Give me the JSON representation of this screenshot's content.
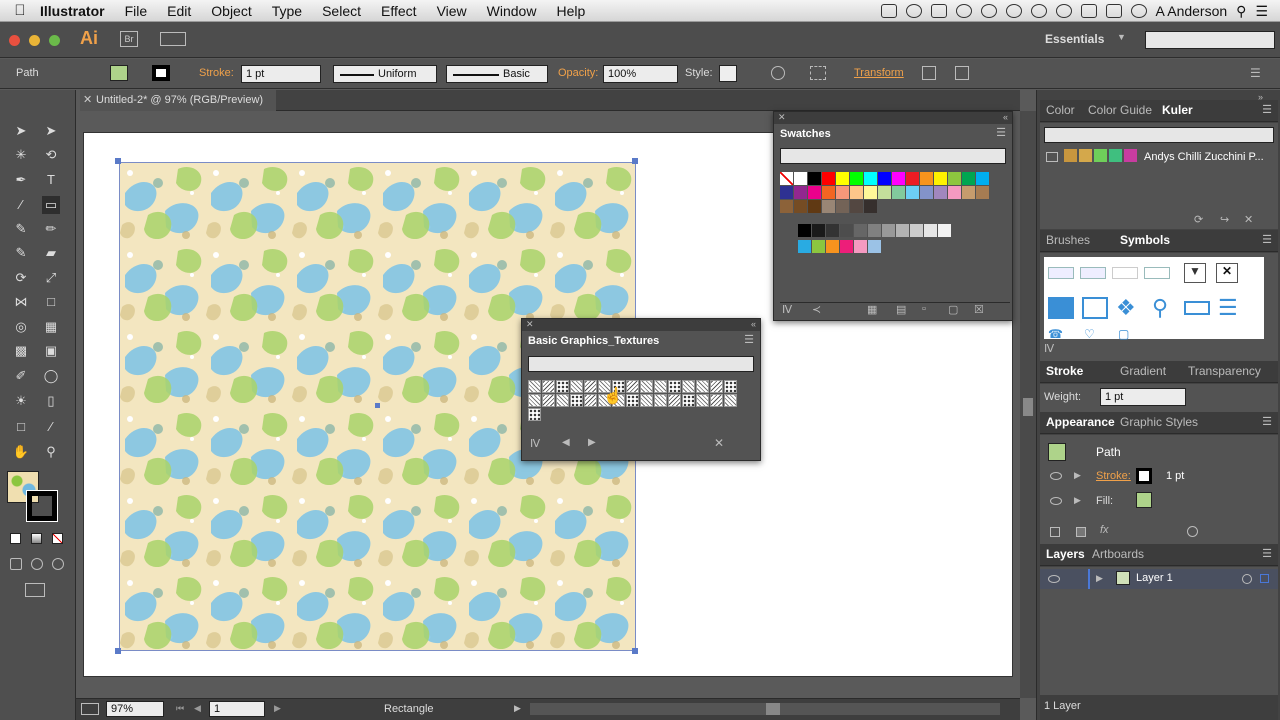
{
  "menubar": {
    "app_name": "Illustrator",
    "items": [
      "File",
      "Edit",
      "Object",
      "Type",
      "Select",
      "Effect",
      "View",
      "Window",
      "Help"
    ],
    "user": "A Anderson"
  },
  "appbar": {
    "logo": "Ai",
    "bridge": "Br",
    "workspace": "Essentials"
  },
  "control": {
    "selection": "Path",
    "stroke_label": "Stroke:",
    "stroke_weight": "1 pt",
    "profile": "Uniform",
    "brush": "Basic",
    "opacity_label": "Opacity:",
    "opacity": "100%",
    "style_label": "Style:",
    "transform": "Transform"
  },
  "document": {
    "tab_title": "Untitled-2* @ 97% (RGB/Preview)"
  },
  "swatches": {
    "title": "Swatches",
    "colors": [
      "#ffffff",
      "#000000",
      "#ff0000",
      "#ffff00",
      "#00ff00",
      "#00ffff",
      "#0000ff",
      "#ff00ff",
      "#ed1c24",
      "#f7941d",
      "#fff200",
      "#8dc63f",
      "#00a651",
      "#00aeef",
      "#2e3192",
      "#92278f",
      "#ec008c",
      "#f26522",
      "#f7977a",
      "#fdc68a",
      "#fff799",
      "#c4df9b",
      "#82ca9d",
      "#6dcff6",
      "#8393ca",
      "#a187be",
      "#f49ac1",
      "#c69c6d",
      "#a67c52",
      "#8c6239",
      "#754c24",
      "#603913",
      "#998675",
      "#736357",
      "#534741",
      "#362f2d"
    ],
    "grays": [
      "#000000",
      "#1a1a1a",
      "#333333",
      "#4d4d4d",
      "#666666",
      "#808080",
      "#999999",
      "#b3b3b3",
      "#cccccc",
      "#e6e6e6",
      "#f2f2f2"
    ],
    "group": [
      "#29abe2",
      "#8cc63f",
      "#f7931e",
      "#ed1e79",
      "#f49ac1",
      "#9bc2e6"
    ]
  },
  "textures": {
    "title": "Basic Graphics_Textures"
  },
  "panels": {
    "color_tabs": [
      "Color",
      "Color Guide",
      "Kuler"
    ],
    "kuler_theme": "Andys  Chilli Zucchini P...",
    "kuler_colors": [
      "#c8963e",
      "#d4a84b",
      "#6fcf5a",
      "#3fbf7f",
      "#c83ca0"
    ],
    "brush_tabs": [
      "Brushes",
      "Symbols"
    ],
    "stroke_tabs": [
      "Stroke",
      "Gradient",
      "Transparency"
    ],
    "weight_label": "Weight:",
    "weight": "1 pt",
    "appearance_tabs": [
      "Appearance",
      "Graphic Styles"
    ],
    "appearance_path": "Path",
    "stroke_row": "Stroke:",
    "stroke_row_value": "1 pt",
    "fill_row": "Fill:",
    "layers_tabs": [
      "Layers",
      "Artboards"
    ],
    "layer_name": "Layer 1",
    "layers_count": "1 Layer"
  },
  "status": {
    "zoom": "97%",
    "artboard": "1",
    "tool": "Rectangle"
  }
}
